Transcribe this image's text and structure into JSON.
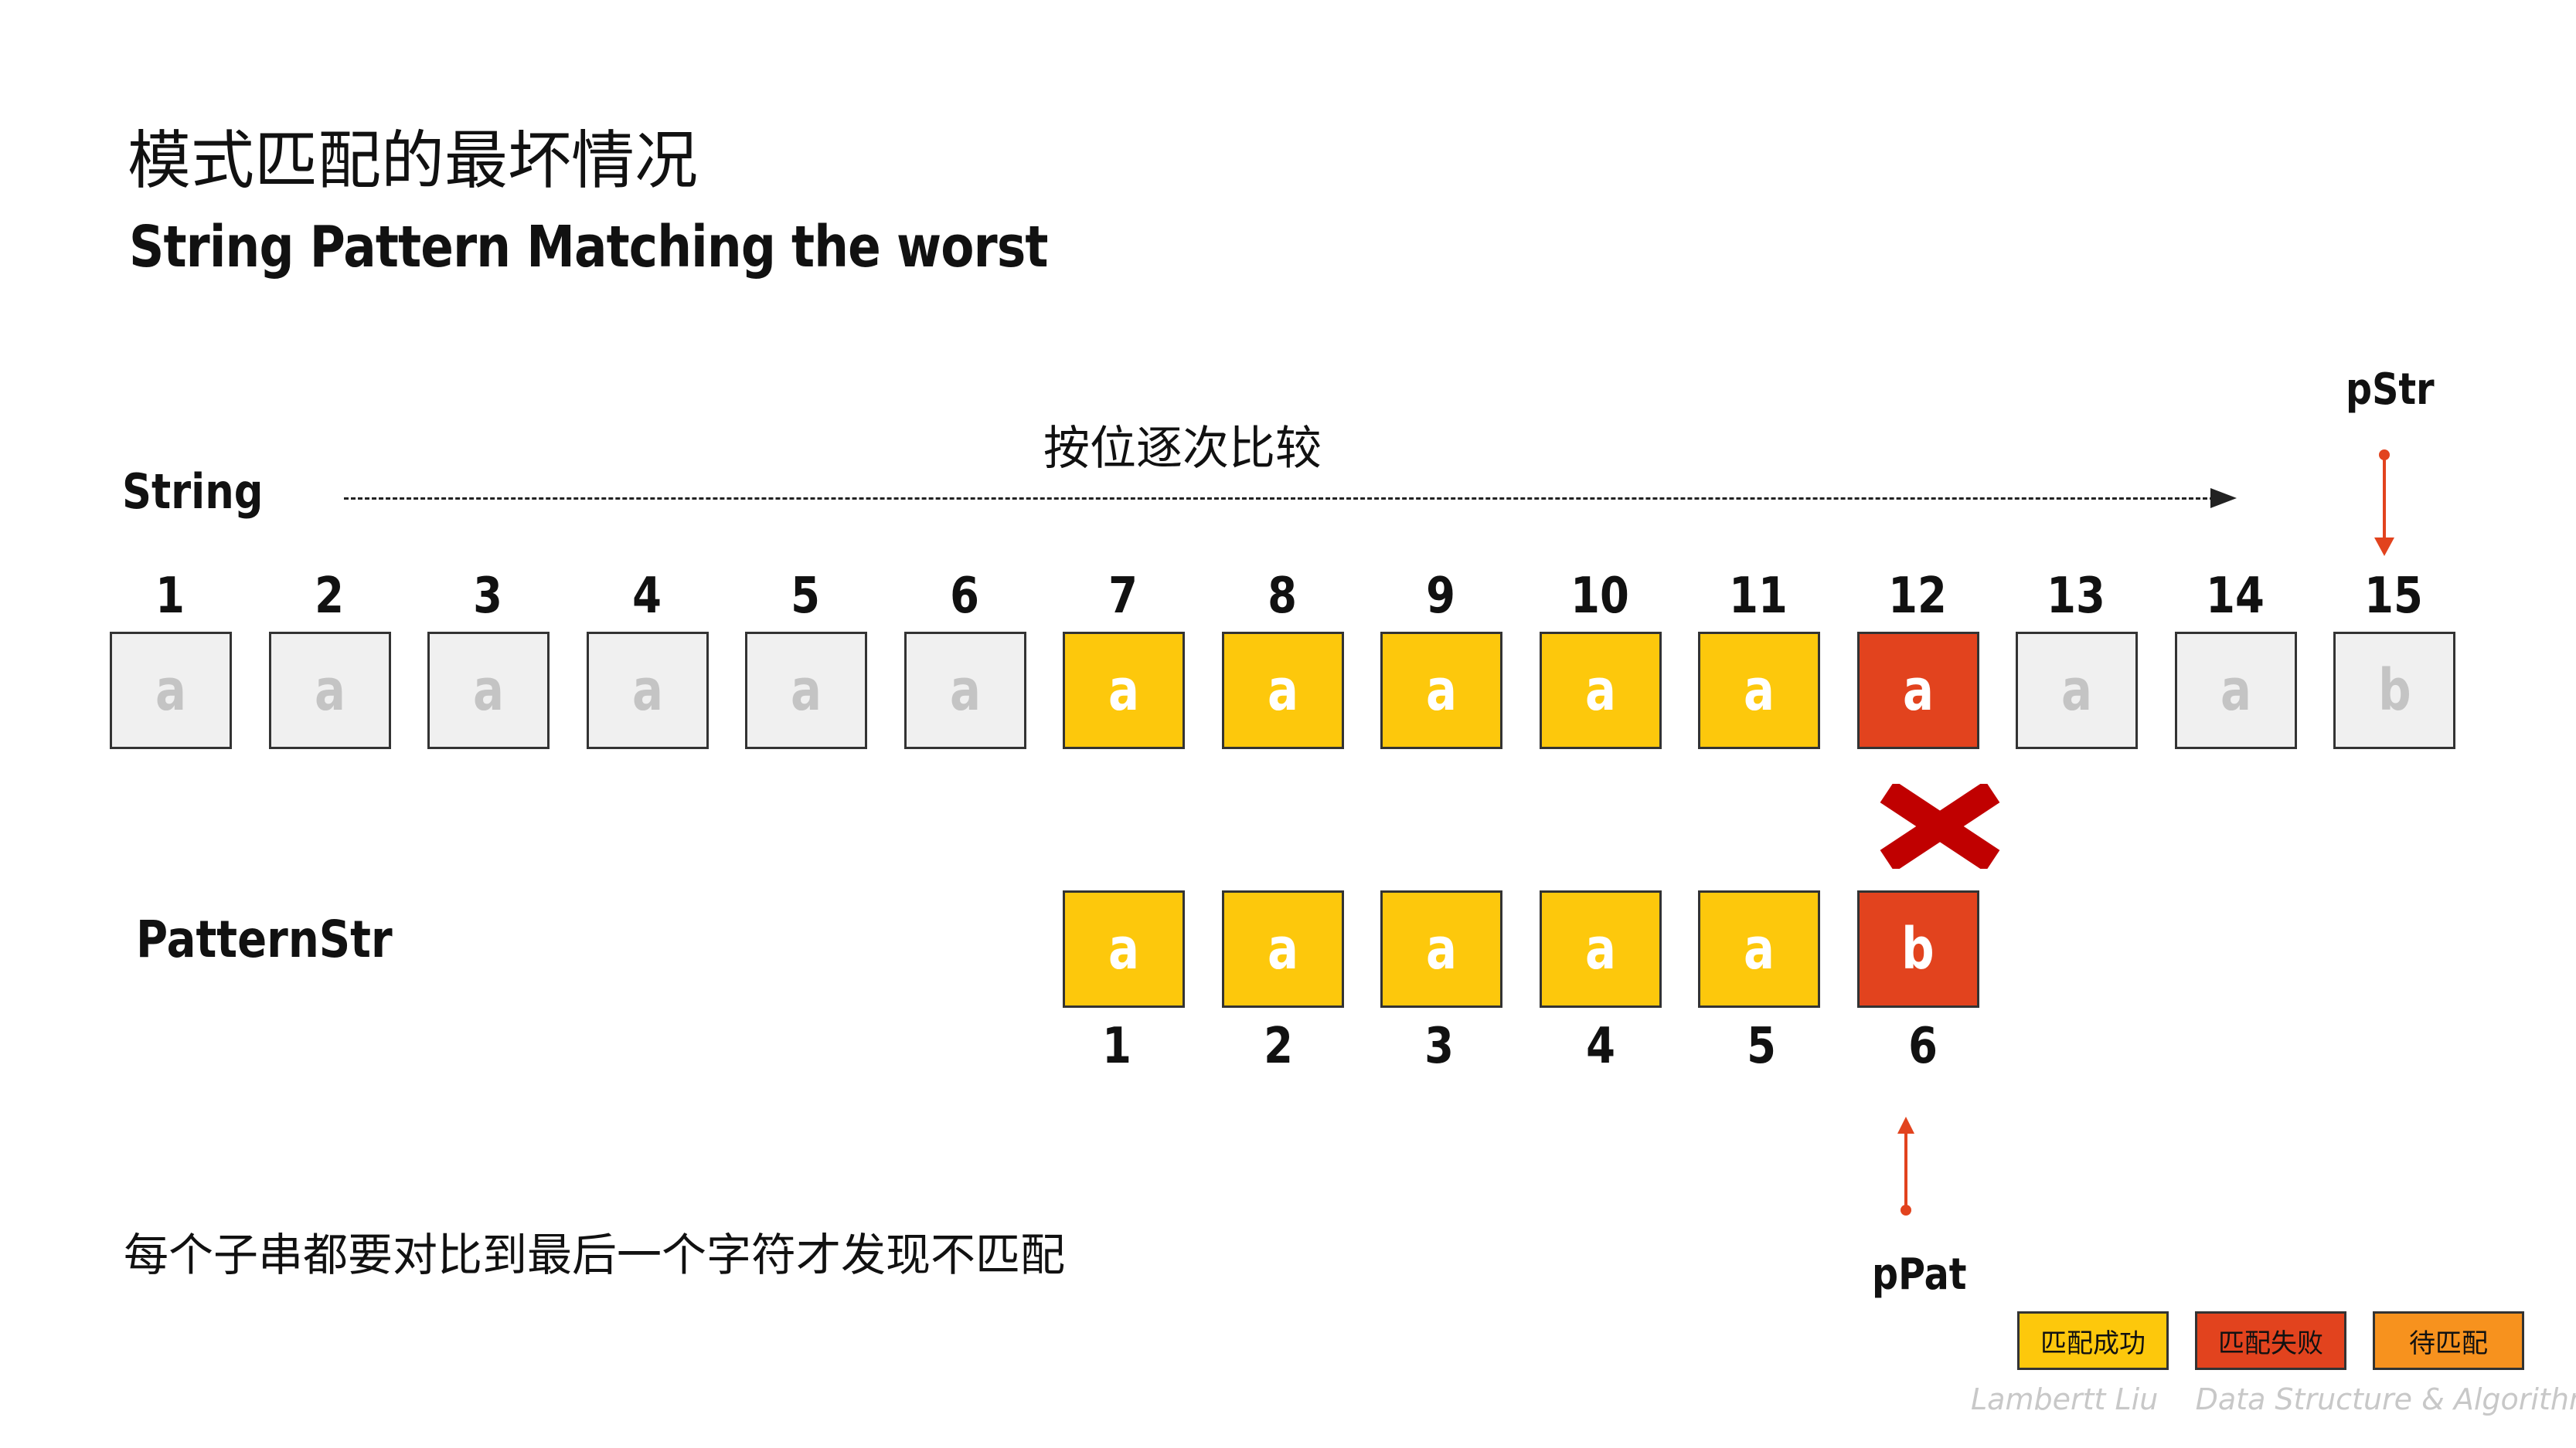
{
  "title": {
    "cn": "模式匹配的最坏情况",
    "en": "String Pattern Matching the worst"
  },
  "labels": {
    "string": "String",
    "pattern": "PatternStr",
    "compare": "按位逐次比较",
    "pStr": "pStr",
    "pPat": "pPat"
  },
  "string": {
    "indices": [
      "1",
      "2",
      "3",
      "4",
      "5",
      "6",
      "7",
      "8",
      "9",
      "10",
      "11",
      "12",
      "13",
      "14",
      "15"
    ],
    "chars": [
      "a",
      "a",
      "a",
      "a",
      "a",
      "a",
      "a",
      "a",
      "a",
      "a",
      "a",
      "a",
      "a",
      "a",
      "b"
    ],
    "states": [
      "pending",
      "pending",
      "pending",
      "pending",
      "pending",
      "pending",
      "match",
      "match",
      "match",
      "match",
      "match",
      "fail",
      "pending",
      "pending",
      "pending"
    ]
  },
  "pattern": {
    "indices": [
      "1",
      "2",
      "3",
      "4",
      "5",
      "6"
    ],
    "chars": [
      "a",
      "a",
      "a",
      "a",
      "a",
      "b"
    ],
    "states": [
      "match",
      "match",
      "match",
      "match",
      "match",
      "fail"
    ]
  },
  "note": "每个子串都要对比到最后一个字符才发现不匹配",
  "legend": [
    {
      "label": "匹配成功",
      "color": "#fdc80c"
    },
    {
      "label": "匹配失败",
      "color": "#e2431e"
    },
    {
      "label": "待匹配",
      "color": "#f7921e"
    }
  ],
  "footer": {
    "author": "Lambertt Liu",
    "course": "Data Structure & Algorithm"
  },
  "colors": {
    "match": "#fdc80c",
    "fail": "#e2431e",
    "pending": "#f0f0f0",
    "cross": "#c00000"
  }
}
